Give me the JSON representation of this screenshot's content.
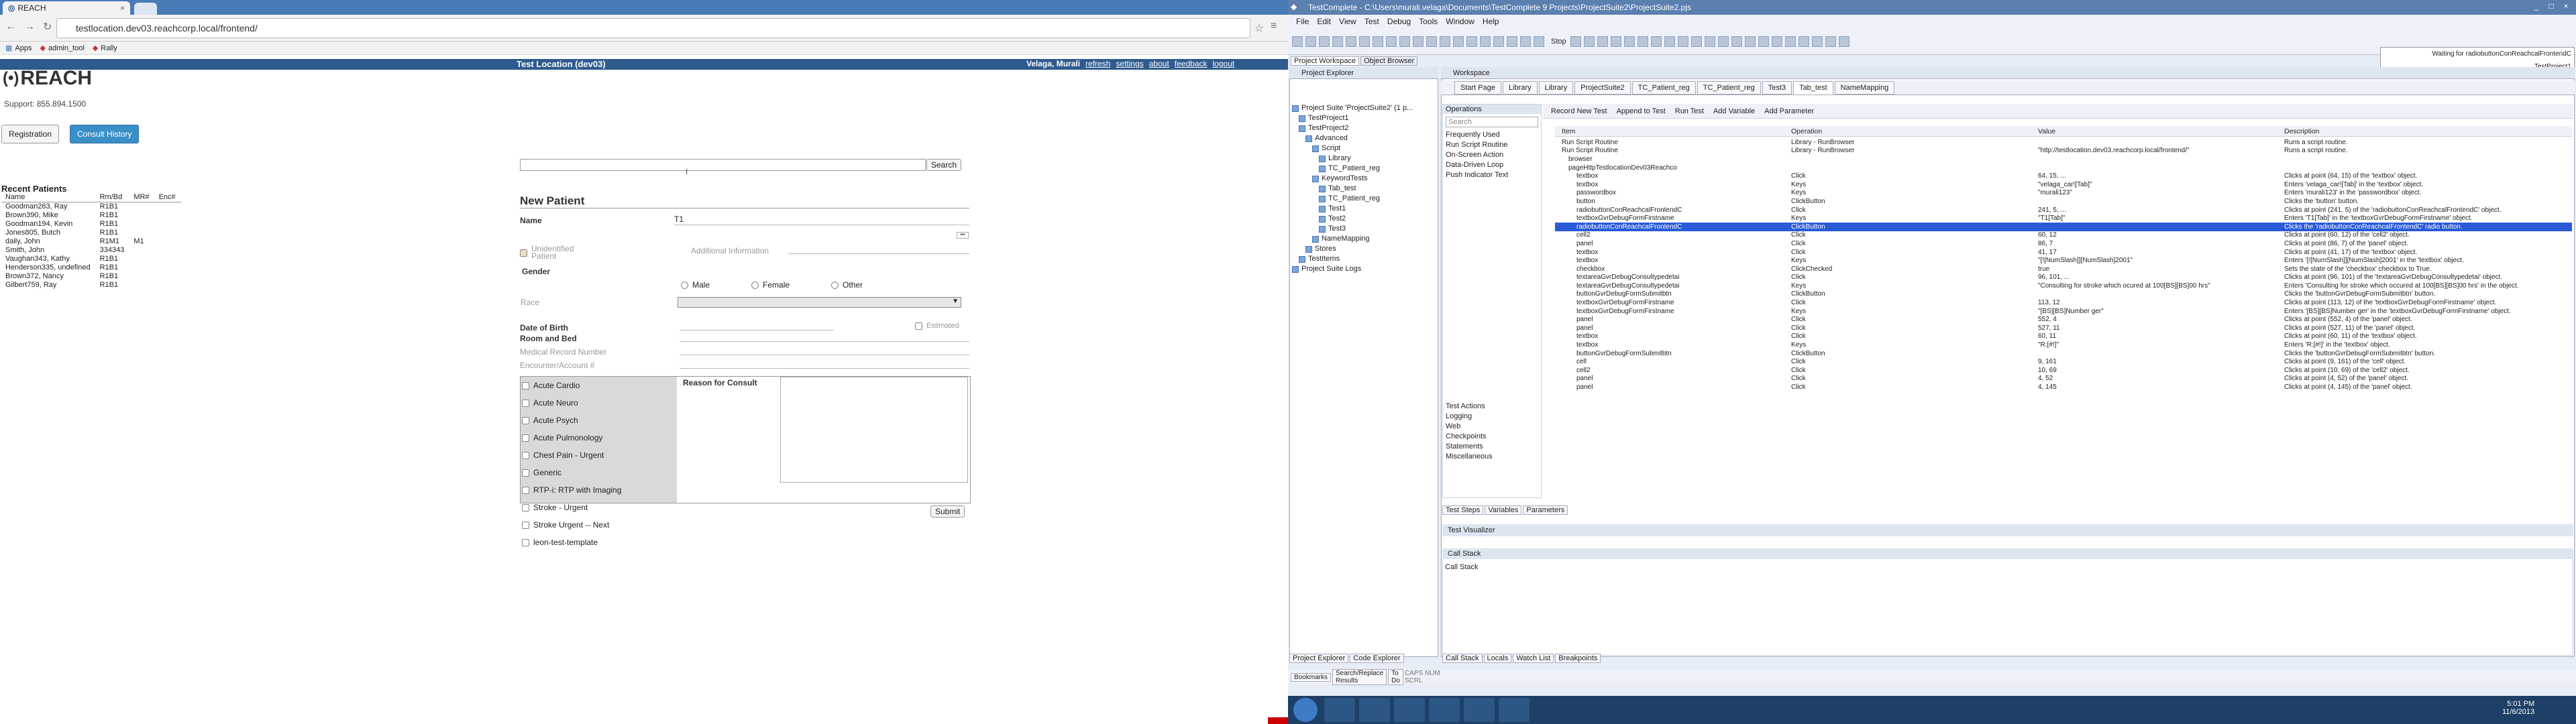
{
  "browser": {
    "tab_title": "REACH",
    "url": "testlocation.dev03.reachcorp.local/frontend/",
    "bookmarks": [
      "Apps",
      "admin_tool",
      "Rally"
    ]
  },
  "reach": {
    "test_location": "Test Location (dev03)",
    "user_menu": [
      "Velaga, Murali",
      "refresh",
      "settings",
      "about",
      "feedback",
      "logout"
    ],
    "logo": "REACH",
    "support": "Support: 855.894.1500",
    "registration_btn": "Registration",
    "consult_history_btn": "Consult History",
    "recent_patients_title": "Recent Patients",
    "recent_headers": [
      "Name",
      "Rm/Bd",
      "MR#",
      "Enc#"
    ],
    "recent_rows": [
      [
        "Goodman263, Ray",
        "R1B1",
        "",
        ""
      ],
      [
        "Brown390, Mike",
        "R1B1",
        "",
        ""
      ],
      [
        "Goodman194, Kevin",
        "R1B1",
        "",
        ""
      ],
      [
        "Jones805, Butch",
        "R1B1",
        "",
        ""
      ],
      [
        "daily, John",
        "R1M1",
        "M1",
        ""
      ],
      [
        "Smith, John",
        "334343",
        "",
        ""
      ],
      [
        "Vaughan343, Kathy",
        "R1B1",
        "",
        ""
      ],
      [
        "Henderson335, undefined",
        "R1B1",
        "",
        ""
      ],
      [
        "Brown372, Nancy",
        "R1B1",
        "",
        ""
      ],
      [
        "Gilbert759, Ray",
        "R1B1",
        "",
        ""
      ]
    ],
    "search_btn": "Search",
    "new_patient_title": "New Patient",
    "name_label": "Name",
    "name_value": "T1",
    "unidentified_label": "Unidentified Patient",
    "additional_info": "Additional Information",
    "gender_label": "Gender",
    "genders": [
      "Male",
      "Female",
      "Other"
    ],
    "race_label": "Race",
    "dob_label": "Date of Birth",
    "estimated_label": "Estimated",
    "room_label": "Room and Bed",
    "mrn_label": "Medical Record Number",
    "encounter_label": "Encounter/Account #",
    "reason_label": "Reason for Consult",
    "reasons": [
      "Acute Cardio",
      "Acute Neuro",
      "Acute Psych",
      "Acute Pulmonology",
      "Chest Pain - Urgent",
      "Generic",
      "RTP-i: RTP with Imaging",
      "Stroke - Urgent",
      "Stroke Urgent -- Next",
      "leon-test-template"
    ],
    "submit_btn": "Submit"
  },
  "tc": {
    "title": "TestComplete - C:\\Users\\murali.velaga\\Documents\\TestComplete 9 Projects\\ProjectSuite2\\ProjectSuite2.pjs",
    "menu": [
      "File",
      "Edit",
      "View",
      "Test",
      "Debug",
      "Tools",
      "Window",
      "Help"
    ],
    "stop_label": "Stop",
    "waiting_text": "Waiting for radiobuttonConReachcalFrontendC",
    "waiting_sub": "TestProject1",
    "workspace_tabs": [
      "Project Workspace",
      "Object Browser"
    ],
    "explorer_title": "Project Explorer",
    "tree": [
      "Project Suite 'ProjectSuite2' (1 p...",
      "TestProject1",
      "TestProject2",
      "Advanced",
      "Script",
      "Library",
      "TC_Patient_reg",
      "KeywordTests",
      "Tab_test",
      "TC_Patient_reg",
      "Test1",
      "Test2",
      "Test3",
      "NameMapping",
      "Stores",
      "TestItems",
      "Project Suite Logs"
    ],
    "workspace_title": "Workspace",
    "doc_tabs": [
      "Start Page",
      "Library",
      "Library",
      "ProjectSuite2",
      "TC_Patient_reg",
      "TC_Patient_reg",
      "Test3",
      "Tab_test",
      "NameMapping"
    ],
    "ops_title": "Operations",
    "ops_search": "Search",
    "ops_items": [
      "Frequently Used",
      "Run Script Routine",
      "On-Screen Action",
      "Data-Driven Loop",
      "Push Indicator Text"
    ],
    "ops_categories": [
      "Test Actions",
      "Logging",
      "Web",
      "Checkpoints",
      "Statements",
      "Miscellaneous"
    ],
    "kt_toolbar": [
      "Record New Test",
      "Append to Test",
      "Run Test",
      "Add Variable",
      "Add Parameter"
    ],
    "grid_headers": [
      "Item",
      "Operation",
      "Value",
      "Description"
    ],
    "grid_rows": [
      [
        "Run Script Routine",
        "Library - RunBrowser",
        "",
        "Runs a script routine."
      ],
      [
        "Run Script Routine",
        "Library - RunBrowser",
        "\"http://testlocation.dev03.reachcorp.local/frontend/\"",
        "Runs a script routine."
      ],
      [
        "browser",
        "",
        "",
        ""
      ],
      [
        "pageHttpTestlocationDev03Reachco",
        "",
        "",
        ""
      ],
      [
        "textbox",
        "Click",
        "64, 15, ...",
        "Clicks at point (64, 15) of the 'textbox' object."
      ],
      [
        "textbox",
        "Keys",
        "\"velaga_car![Tab]\"",
        "Enters 'velaga_car![Tab]' in the 'textbox' object."
      ],
      [
        "passwordbox",
        "Keys",
        "\"murali123\"",
        "Enters 'murali123' in the 'passwordbox' object."
      ],
      [
        "button",
        "ClickButton",
        "",
        "Clicks the 'button' button."
      ],
      [
        "radiobuttonConReachcalFrontendC",
        "Click",
        "241, 5, ...",
        "Clicks at point (241, 5) of the 'radiobuttonConReachcalFrontendC' object."
      ],
      [
        "textboxGvrDebugFormFirstname",
        "Keys",
        "\"T1[Tab]\"",
        "Enters 'T1[Tab]' in the 'textboxGvrDebugFormFirstname' object."
      ],
      [
        "radiobuttonConReachcalFrontendC",
        "ClickButton",
        "",
        "Clicks the 'radiobuttonConReachcalFrontendC' radio button."
      ],
      [
        "cell2",
        "Click",
        "60, 12",
        "Clicks at point (60, 12) of the 'cell2' object."
      ],
      [
        "panel",
        "Click",
        "86, 7",
        "Clicks at point (86, 7) of the 'panel' object."
      ],
      [
        "textbox",
        "Click",
        "41, 17",
        "Clicks at point (41, 17) of the 'textbox' object."
      ],
      [
        "textbox",
        "Keys",
        "\"[![NumSlash]][NumSlash]2001\"",
        "Enters '[![NumSlash]][NumSlash]2001' in the 'textbox' object."
      ],
      [
        "checkbox",
        "ClickChecked",
        "true",
        "Sets the state of the 'checkbox' checkbox to True."
      ],
      [
        "textareaGvrDebugConsultypedetai",
        "Click",
        "96, 101, ...",
        "Clicks at point (96, 101) of the 'textareaGvrDebugConsultypedetai' object."
      ],
      [
        "textareaGvrDebugConsultypedetai",
        "Keys",
        "\"Consulting for stroke which ocured at 100[BS][BS]00 hrs\"",
        "Enters 'Consulting for stroke which occured at 100[BS][BS]00 hrs' in the object."
      ],
      [
        "buttonGvrDebugFormSubmitbtn",
        "ClickButton",
        "",
        "Clicks the 'buttonGvrDebugFormSubmitbtn' button."
      ],
      [
        "textboxGvrDebugFormFirstname",
        "Click",
        "113, 12",
        "Clicks at point (113, 12) of the 'textboxGvrDebugFormFirstname' object."
      ],
      [
        "textboxGvrDebugFormFirstname",
        "Keys",
        "\"[BS][BS]Number ger\"",
        "Enters '[BS][BS]Number ger' in the 'textboxGvrDebugFormFirstname' object."
      ],
      [
        "panel",
        "Click",
        "552, 4",
        "Clicks at point (552, 4) of the 'panel' object."
      ],
      [
        "panel",
        "Click",
        "527, 11",
        "Clicks at point (527, 11) of the 'panel' object."
      ],
      [
        "textbox",
        "Click",
        "60, 11",
        "Clicks at point (60, 11) of the 'textbox' object."
      ],
      [
        "textbox",
        "Keys",
        "\"R:[#!]\"",
        "Enters 'R:[#!]' in the 'textbox' object."
      ],
      [
        "buttonGvrDebugFormSubmitbtn",
        "ClickButton",
        "",
        "Clicks the 'buttonGvrDebugFormSubmitbtn' button."
      ],
      [
        "cell",
        "Click",
        "9, 161",
        "Clicks at point (9, 161) of the 'cell' object."
      ],
      [
        "cell2",
        "Click",
        "10, 69",
        "Clicks at point (10, 69) of the 'cell2' object."
      ],
      [
        "panel",
        "Click",
        "4, 52",
        "Clicks at point (4, 52) of the 'panel' object."
      ],
      [
        "panel",
        "Click",
        "4, 145",
        "Clicks at point (4, 145) of the 'panel' object."
      ]
    ],
    "bottom_tabs1": [
      "Test Steps",
      "Variables",
      "Parameters"
    ],
    "test_visualizer": "Test Visualizer",
    "call_stack_title": "Call Stack",
    "call_stack_body": "Call Stack",
    "bottom_tabs2": [
      "Call Stack",
      "Locals",
      "Watch List",
      "Breakpoints"
    ],
    "left_tabs": [
      "Project Explorer",
      "Code Explorer"
    ],
    "status_tabs": [
      "Bookmarks",
      "Search/Replace Results",
      "To Do"
    ],
    "status_caps": "CAPS NUM SCRL",
    "clock_time": "5:01 PM",
    "clock_date": "11/6/2013"
  }
}
